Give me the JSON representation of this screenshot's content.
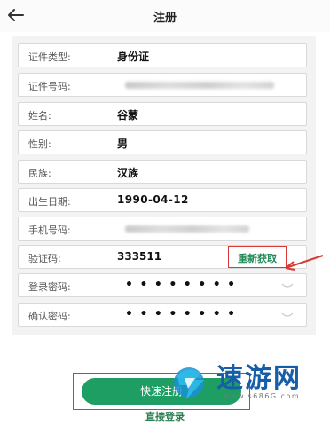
{
  "header": {
    "title": "注册",
    "back_icon": "arrow-left-icon"
  },
  "fields": [
    {
      "label": "证件类型:",
      "value": "身份证"
    },
    {
      "label": "证件号码:",
      "value": ""
    },
    {
      "label": "姓名:",
      "value": "谷蒙"
    },
    {
      "label": "性别:",
      "value": "男"
    },
    {
      "label": "民族:",
      "value": "汉族"
    },
    {
      "label": "出生日期:",
      "value": "1990-04-12"
    },
    {
      "label": "手机号码:",
      "value": ""
    },
    {
      "label": "验证码:",
      "value": "333511"
    },
    {
      "label": "登录密码:",
      "value": "••••••••"
    },
    {
      "label": "确认密码:",
      "value": "••••••••"
    }
  ],
  "verification": {
    "resend_label": "重新获取"
  },
  "actions": {
    "submit_label": "快速注册",
    "login_link": "直接登录"
  },
  "watermark": {
    "brand": "速游网",
    "url": "www.s686G.com"
  },
  "colors": {
    "accent_green": "#1f9e64",
    "annotation_red": "#d93a35",
    "watermark_blue": "#175ea8"
  }
}
